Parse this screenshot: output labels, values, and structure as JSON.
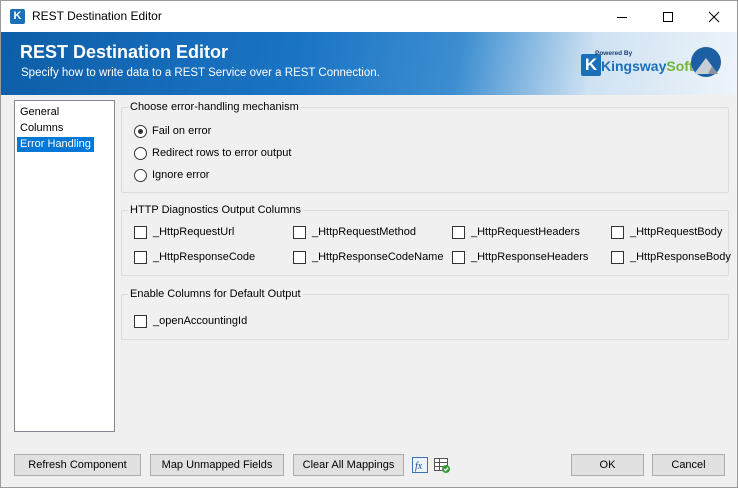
{
  "window": {
    "title": "REST Destination Editor",
    "app_icon_letter": "K"
  },
  "banner": {
    "title": "REST Destination Editor",
    "subtitle": "Specify how to write data to a REST Service over a REST Connection.",
    "logo": {
      "powered_by": "Powered By",
      "name_main": "Kingsway",
      "name_accent": "Soft",
      "icon": "kingswaysoft-logo"
    },
    "mountain_icon": "mountain-icon"
  },
  "nav": {
    "items": [
      {
        "label": "General",
        "selected": false
      },
      {
        "label": "Columns",
        "selected": false
      },
      {
        "label": "Error Handling",
        "selected": true
      }
    ]
  },
  "error_handling": {
    "group_title": "Choose error-handling mechanism",
    "options": [
      {
        "label": "Fail on error",
        "checked": true
      },
      {
        "label": "Redirect rows to error output",
        "checked": false
      },
      {
        "label": "Ignore error",
        "checked": false
      }
    ]
  },
  "diagnostics": {
    "group_title": "HTTP Diagnostics Output Columns",
    "columns": [
      {
        "label": "_HttpRequestUrl",
        "checked": false
      },
      {
        "label": "_HttpRequestMethod",
        "checked": false
      },
      {
        "label": "_HttpRequestHeaders",
        "checked": false
      },
      {
        "label": "_HttpRequestBody",
        "checked": false
      },
      {
        "label": "_HttpResponseCode",
        "checked": false
      },
      {
        "label": "_HttpResponseCodeName",
        "checked": false
      },
      {
        "label": "_HttpResponseHeaders",
        "checked": false
      },
      {
        "label": "_HttpResponseBody",
        "checked": false
      }
    ]
  },
  "default_output": {
    "group_title": "Enable Columns for Default Output",
    "columns": [
      {
        "label": "_openAccountingId",
        "checked": false
      }
    ]
  },
  "footer": {
    "refresh_label": "Refresh Component",
    "map_unmapped_label": "Map Unmapped Fields",
    "clear_mappings_label": "Clear All Mappings",
    "expression_icon": "fx-icon",
    "grid_icon": "grid-check-icon",
    "ok_label": "OK",
    "cancel_label": "Cancel"
  }
}
